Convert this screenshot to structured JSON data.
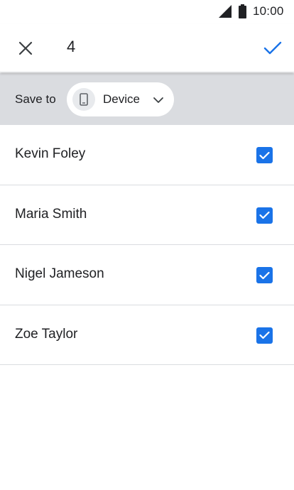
{
  "status_bar": {
    "time": "10:00",
    "icons": [
      "signal-icon",
      "battery-icon"
    ]
  },
  "top_bar": {
    "close_icon": "close-icon",
    "selected_count": "4",
    "done_icon": "check-icon"
  },
  "save_bar": {
    "label": "Save to",
    "destination": {
      "label": "Device",
      "icon": "phone-icon",
      "dropdown_icon": "chevron-down-icon"
    }
  },
  "contacts": [
    {
      "name": "Kevin Foley",
      "checked": true
    },
    {
      "name": "Maria Smith",
      "checked": true
    },
    {
      "name": "Nigel Jameson",
      "checked": true
    },
    {
      "name": "Zoe Taylor",
      "checked": true
    }
  ],
  "colors": {
    "accent": "#1a73e8",
    "save_bar_bg": "#dadce0",
    "divider": "#dadce0",
    "text": "#202124"
  }
}
